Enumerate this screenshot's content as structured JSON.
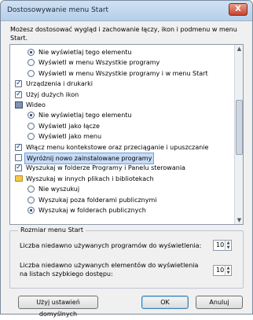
{
  "window": {
    "title": "Dostosowywanie menu Start",
    "close_glyph": "X"
  },
  "description": "Możesz dostosować wygląd i zachowanie łączy, ikon i podmenu w menu Start.",
  "list_items": [
    {
      "type": "radio",
      "checked": true,
      "indent": 2,
      "label": "Nie wyświetlaj tego elementu"
    },
    {
      "type": "radio",
      "checked": false,
      "indent": 2,
      "label": "Wyświetl w menu Wszystkie programy"
    },
    {
      "type": "radio",
      "checked": false,
      "indent": 2,
      "label": "Wyświetl w menu Wszystkie programy i w menu Start"
    },
    {
      "type": "checkbox",
      "checked": true,
      "indent": 1,
      "label": "Urządzenia i drukarki"
    },
    {
      "type": "checkbox",
      "checked": true,
      "indent": 1,
      "label": "Użyj dużych ikon"
    },
    {
      "type": "icon",
      "icon": "video-icon",
      "indent": 1,
      "label": "Wideo"
    },
    {
      "type": "radio",
      "checked": true,
      "indent": 2,
      "label": "Nie wyświetlaj tego elementu"
    },
    {
      "type": "radio",
      "checked": false,
      "indent": 2,
      "label": "Wyświetl jako łącze"
    },
    {
      "type": "radio",
      "checked": false,
      "indent": 2,
      "label": "Wyświetl jako menu"
    },
    {
      "type": "checkbox",
      "checked": true,
      "indent": 1,
      "label": "Włącz menu kontekstowe oraz przeciąganie i upuszczanie"
    },
    {
      "type": "checkbox",
      "checked": false,
      "indent": 1,
      "label": "Wyróżnij nowo zainstalowane programy",
      "highlighted": true
    },
    {
      "type": "checkbox",
      "checked": true,
      "indent": 1,
      "label": "Wyszukaj w folderze Programy i Panelu sterowania"
    },
    {
      "type": "icon",
      "icon": "folder-icon",
      "indent": 1,
      "label": "Wyszukaj w innych plikach i bibliotekach"
    },
    {
      "type": "radio",
      "checked": false,
      "indent": 2,
      "label": "Nie wyszukuj"
    },
    {
      "type": "radio",
      "checked": false,
      "indent": 2,
      "label": "Wyszukaj poza folderami publicznymi"
    },
    {
      "type": "radio",
      "checked": true,
      "indent": 2,
      "label": "Wyszukaj w folderach publicznych"
    }
  ],
  "size_group": {
    "title": "Rozmiar menu Start",
    "recent_programs_label": "Liczba niedawno używanych programów do wyświetlenia:",
    "recent_programs_value": "10",
    "recent_items_label_line1": "Liczba niedawno używanych elementów do wyświetlenia",
    "recent_items_label_line2": "na listach szybkiego dostępu:",
    "recent_items_value": "10"
  },
  "buttons": {
    "defaults": "Użyj ustawień domyślnych",
    "ok": "OK",
    "cancel": "Anuluj"
  },
  "glyphs": {
    "up": "▲",
    "down": "▼"
  }
}
